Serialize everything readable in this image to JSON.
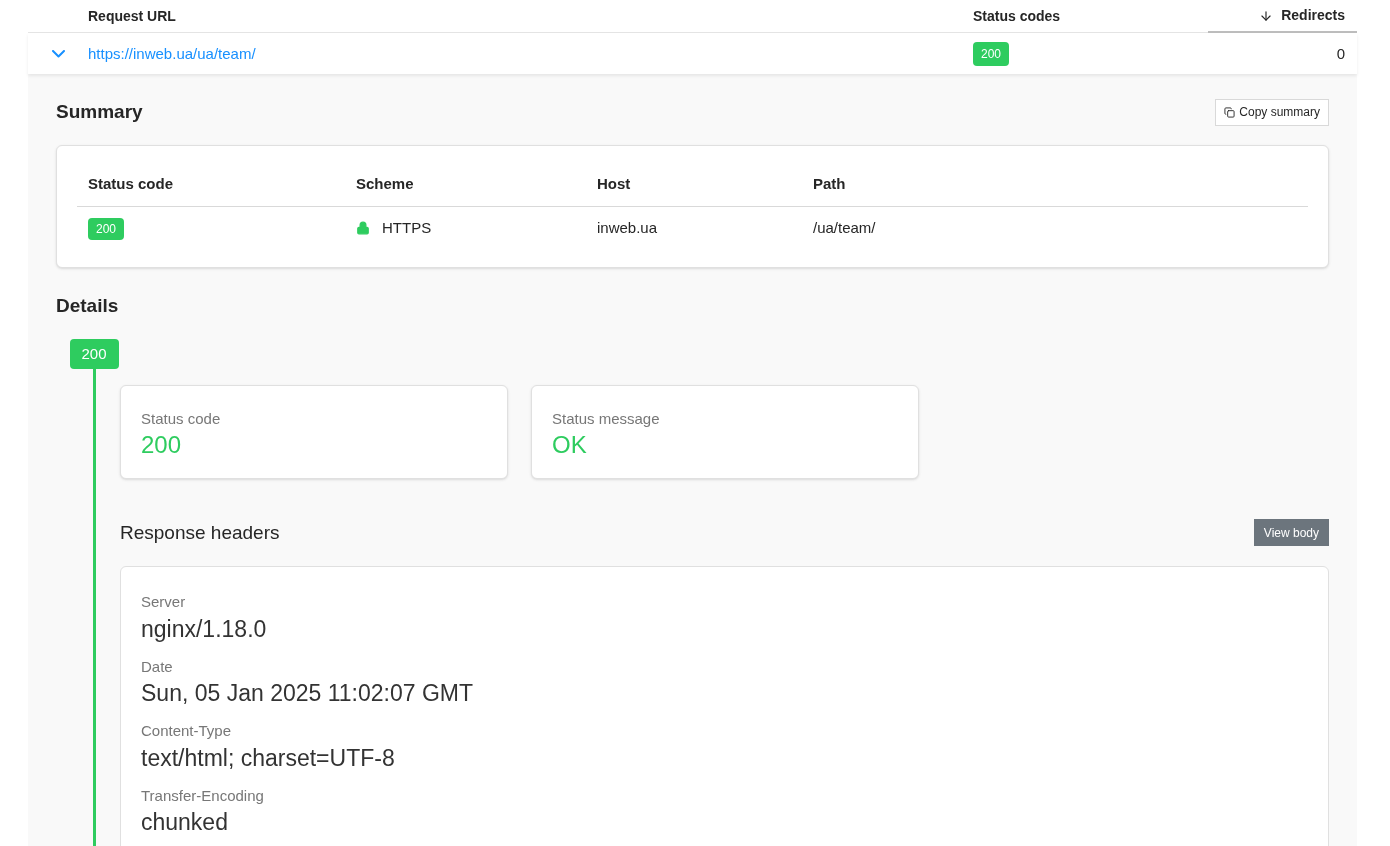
{
  "table": {
    "columns": [
      {
        "label": "Request URL",
        "sorted": false
      },
      {
        "label": "Status codes",
        "sorted": false
      },
      {
        "label": "Redirects",
        "sorted": true
      }
    ],
    "rows": [
      {
        "expanded": true,
        "url": "https://inweb.ua/ua/team/",
        "status_codes": [
          "200"
        ],
        "redirects": "0",
        "summary": {
          "title": "Summary",
          "copy_button": "Copy summary",
          "columns": [
            "Status code",
            "Scheme",
            "Host",
            "Path"
          ],
          "status_code": "200",
          "scheme": "HTTPS",
          "secure": true,
          "host": "inweb.ua",
          "path": "/ua/team/"
        },
        "details": {
          "title": "Details",
          "steps": [
            {
              "badge": "200",
              "stats": [
                {
                  "label": "Status code",
                  "value": "200"
                },
                {
                  "label": "Status message",
                  "value": "OK"
                }
              ],
              "headers_title": "Response headers",
              "view_body_button": "View body",
              "headers": [
                {
                  "name": "Server",
                  "value": "nginx/1.18.0"
                },
                {
                  "name": "Date",
                  "value": "Sun, 05 Jan 2025 11:02:07 GMT"
                },
                {
                  "name": "Content-Type",
                  "value": "text/html; charset=UTF-8"
                },
                {
                  "name": "Transfer-Encoding",
                  "value": "chunked"
                }
              ]
            }
          ]
        }
      }
    ]
  }
}
